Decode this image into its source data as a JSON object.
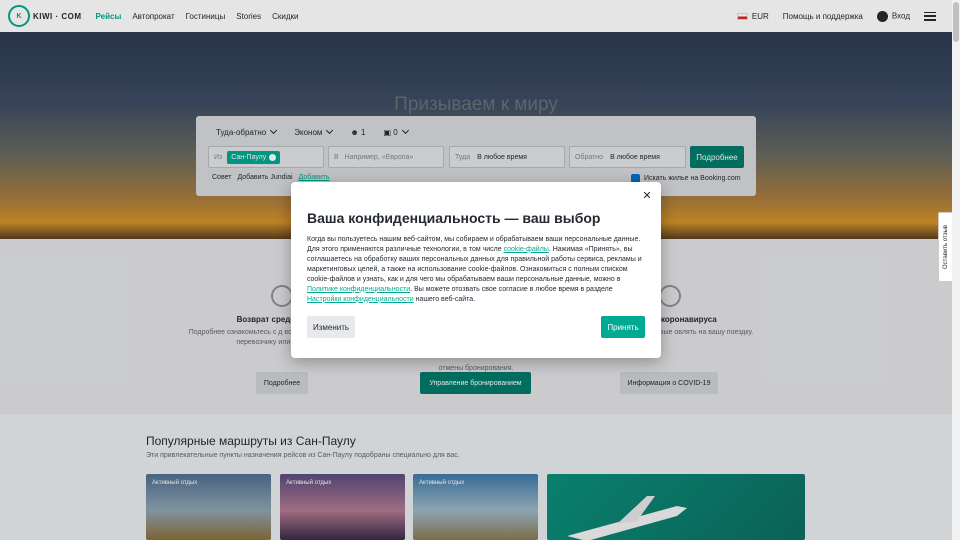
{
  "header": {
    "logo_text": "KIWI · COM",
    "nav": [
      "Рейсы",
      "Автопрокат",
      "Гостиницы",
      "Stories",
      "Скидки"
    ],
    "currency": "EUR",
    "help": "Помощь и поддержка",
    "login": "Вход"
  },
  "hero": {
    "title": "Призываем к миру"
  },
  "search": {
    "trip_type": "Туда-обратно",
    "cabin": "Эконом",
    "passengers": "1",
    "bags": "0",
    "from_label": "Из",
    "from_value": "Сан-Паулу",
    "to_label": "В",
    "to_placeholder": "Например, «Европа»",
    "depart_label": "Туда",
    "depart_value": "В любое время",
    "return_label": "Обратно",
    "return_value": "В любое время",
    "submit": "Подробнее",
    "tip_label": "Совет",
    "tip_text": "Добавить Jundiai",
    "tip_link": "Добавить",
    "booking_label": "Искать жилье на Booking.com"
  },
  "info": {
    "col1_title": "Возврат средств и отм",
    "col1_text": "Подробнее ознакомьтесь с д возврата средств: самостоя перевозчику или мгновенны",
    "col1_btn": "Подробнее",
    "col2_text": "отмены бронирования.",
    "col2_btn": "Управление бронированием",
    "col3_title": "ношении коронавируса",
    "col3_text": "ормацию о том, как новые овлять на вашу поездку.",
    "col3_btn": "Информация о COVID-19"
  },
  "popular": {
    "title": "Популярные маршруты из Сан-Паулу",
    "subtitle": "Эти привлекательные пункты назначения рейсов из Сан-Паулу подобраны специально для вас.",
    "cards": [
      "Активный отдых",
      "Активный отдых",
      "Активный отдых"
    ]
  },
  "modal": {
    "title": "Ваша конфиденциальность — ваш выбор",
    "p1": "Когда вы пользуетесь нашим веб-сайтом, мы собираем и обрабатываем ваши персональные данные. Для этого применяются различные технологии, в том числе ",
    "link1": "cookie-файлы",
    "p2": ". Нажимая «Принять», вы соглашаетесь на обработку ваших персональных данных для правильной работы сервиса, рекламы и маркетинговых целей, а также на использование cookie-файлов. Ознакомиться с полным списком cookie-файлов и узнать, как и для чего мы обрабатываем ваши персональные данные, можно в ",
    "link2": "Политике конфиденциальности",
    "p3": ". Вы можете отозвать свое согласие в любое время в разделе ",
    "link3": "Настройки конфиденциальности",
    "p4": " нашего веб-сайта.",
    "change_btn": "Изменить",
    "accept_btn": "Принять"
  },
  "feedback": "Оставить отзыв",
  "colors": {
    "brand": "#00a991",
    "brand_dark": "#007a69"
  }
}
